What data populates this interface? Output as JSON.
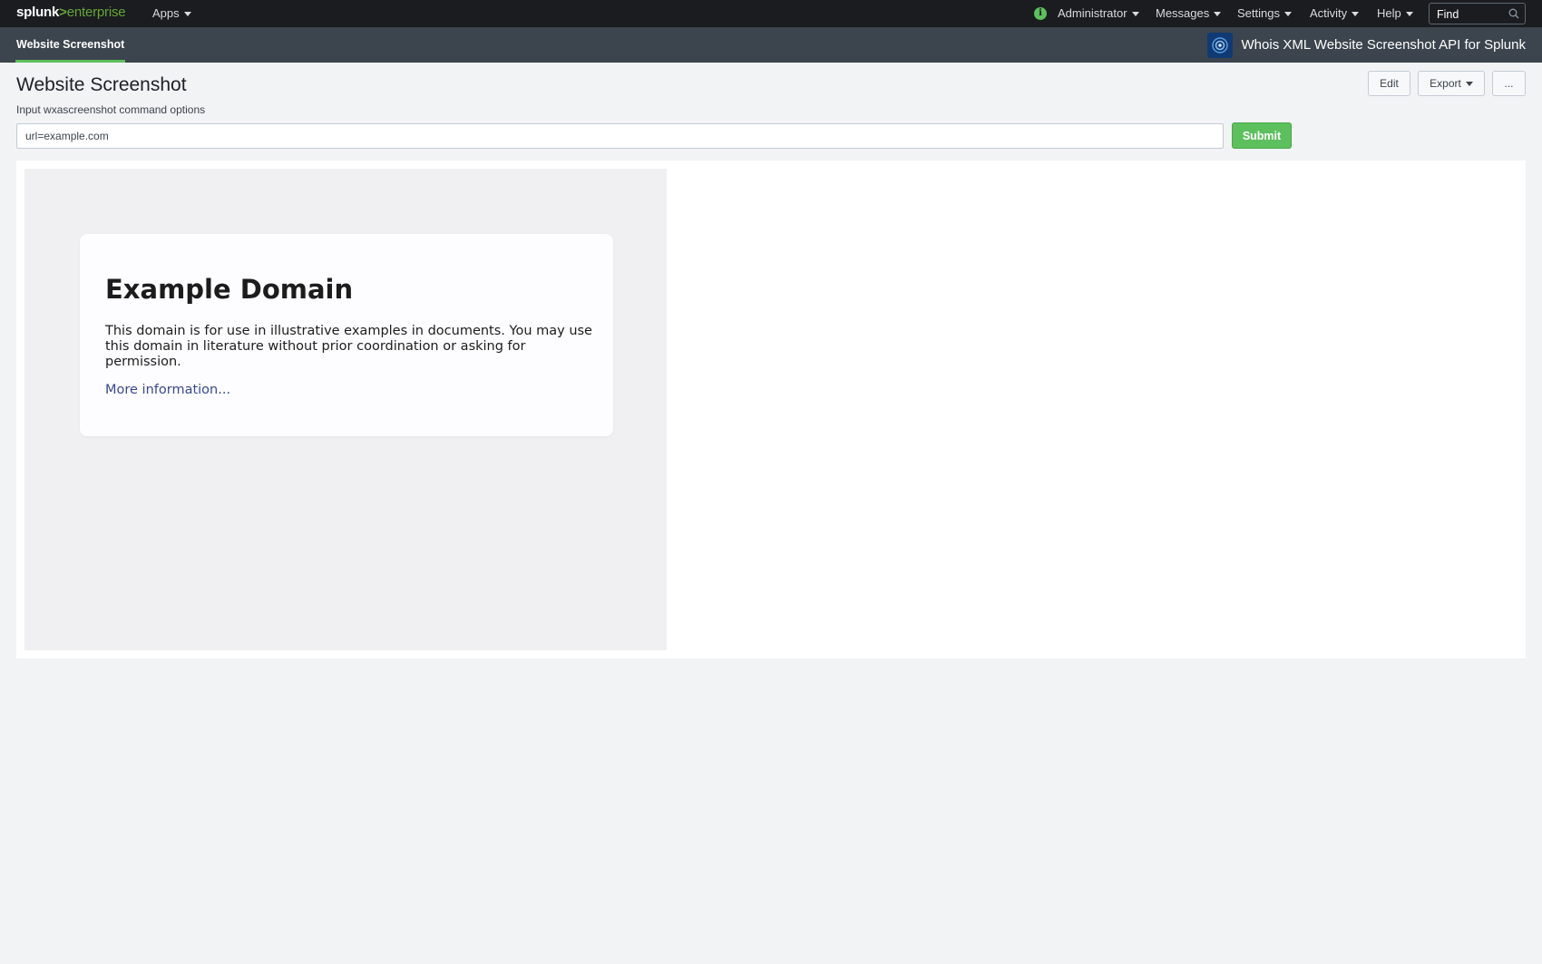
{
  "topbar": {
    "logo_splunk": "splunk",
    "logo_gt": ">",
    "logo_enterprise": "enterprise",
    "apps_label": "Apps",
    "user_label": "Administrator",
    "messages_label": "Messages",
    "settings_label": "Settings",
    "activity_label": "Activity",
    "help_label": "Help",
    "find_placeholder": "Find"
  },
  "appbar": {
    "tab_label": "Website Screenshot",
    "app_title": "Whois XML Website Screenshot API for Splunk"
  },
  "dashboard": {
    "title": "Website Screenshot",
    "edit_label": "Edit",
    "export_label": "Export",
    "more_label": "...",
    "input_label": "Input wxascreenshot command options",
    "input_value": "url=example.com",
    "submit_label": "Submit"
  },
  "screenshot": {
    "heading": "Example Domain",
    "body": "This domain is for use in illustrative examples in documents. You may use this domain in literature without prior coordination or asking for permission.",
    "link_text": "More information..."
  },
  "colors": {
    "topbar_bg": "#1a1c20",
    "appbar_bg": "#3c444d",
    "accent_green": "#5cc05c",
    "page_bg": "#f2f3f5",
    "link_blue": "#38488f"
  },
  "icons": {
    "find": "search-icon",
    "status": "info-icon",
    "app_logo": "whoisxml-logo-icon"
  }
}
